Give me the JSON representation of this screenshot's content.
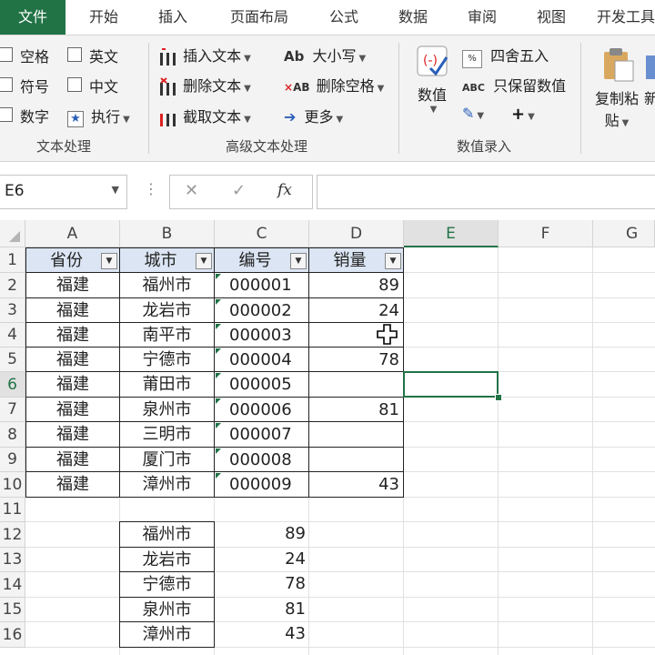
{
  "tabs": [
    "文件",
    "开始",
    "插入",
    "页面布局",
    "公式",
    "数据",
    "审阅",
    "视图",
    "开发工具"
  ],
  "ribbon": {
    "text_group": {
      "checkboxes": [
        "空格",
        "英文",
        "符号",
        "中文",
        "数字"
      ],
      "exec_label": "执行",
      "label": "文本处理"
    },
    "advanced_group": {
      "items": [
        "插入文本",
        "删除文本",
        "截取文本",
        "大小写",
        "删除空格",
        "更多"
      ],
      "label": "高级文本处理"
    },
    "number_group": {
      "big_button": "数值",
      "items": [
        "四舍五入",
        "只保留数值"
      ],
      "label": "数值录入"
    },
    "paste_group": {
      "button": "复制粘",
      "button_line2": "贴",
      "next_char": "新"
    }
  },
  "formula_bar": {
    "name_box": "E6",
    "fx": "fx",
    "formula": ""
  },
  "grid": {
    "columns": [
      "A",
      "B",
      "C",
      "D",
      "E",
      "F",
      "G"
    ],
    "rows": [
      "1",
      "2",
      "3",
      "4",
      "5",
      "6",
      "7",
      "8",
      "9",
      "10",
      "11",
      "12",
      "13",
      "14",
      "15",
      "16"
    ],
    "headers": [
      "省份",
      "城市",
      "编号",
      "销量"
    ],
    "table": [
      [
        "福建",
        "福州市",
        "000001",
        "89"
      ],
      [
        "福建",
        "龙岩市",
        "000002",
        "24"
      ],
      [
        "福建",
        "南平市",
        "000003",
        ""
      ],
      [
        "福建",
        "宁德市",
        "000004",
        "78"
      ],
      [
        "福建",
        "莆田市",
        "000005",
        ""
      ],
      [
        "福建",
        "泉州市",
        "000006",
        "81"
      ],
      [
        "福建",
        "三明市",
        "000007",
        ""
      ],
      [
        "福建",
        "厦门市",
        "000008",
        ""
      ],
      [
        "福建",
        "漳州市",
        "000009",
        "43"
      ]
    ],
    "lower": [
      [
        "福州市",
        "89"
      ],
      [
        "龙岩市",
        "24"
      ],
      [
        "宁德市",
        "78"
      ],
      [
        "泉州市",
        "81"
      ],
      [
        "漳州市",
        "43"
      ]
    ]
  },
  "colors": {
    "accent": "#217346",
    "header_fill": "#dbe5f3"
  }
}
